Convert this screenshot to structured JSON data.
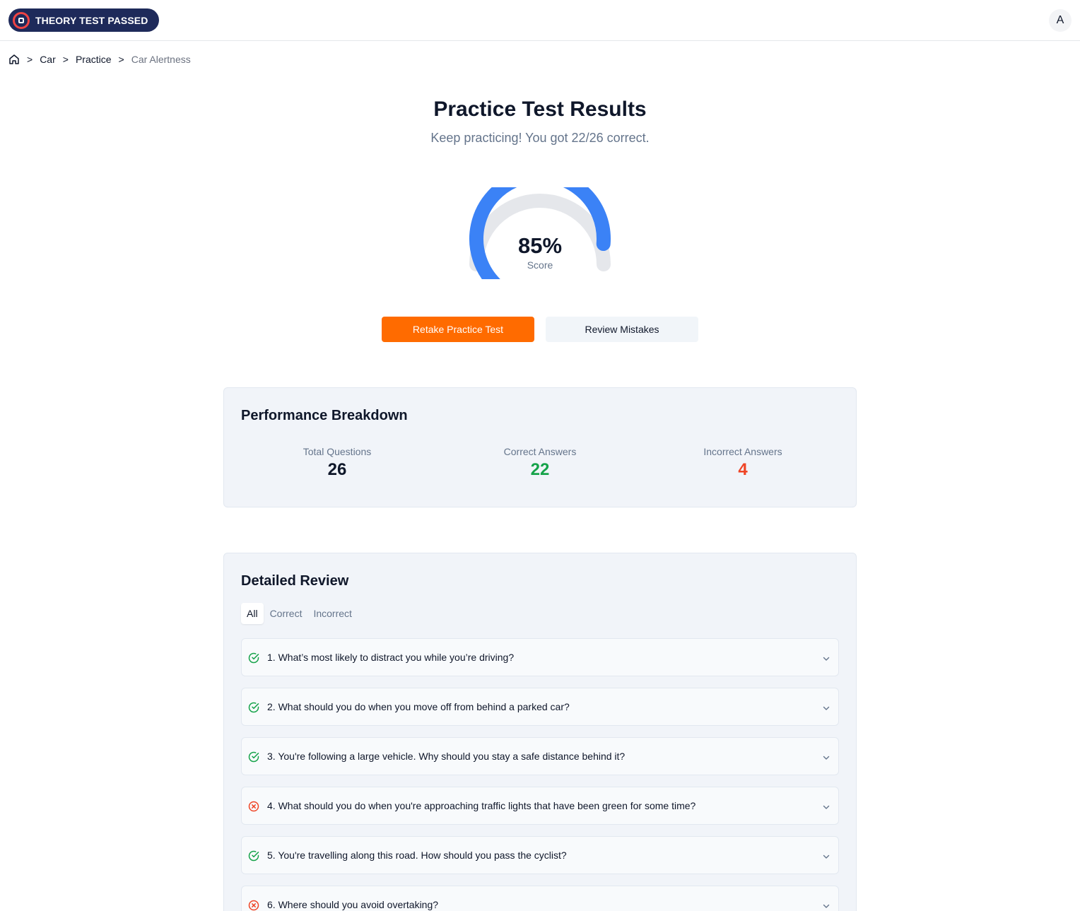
{
  "brand": {
    "name": "THEORY TEST PASSED"
  },
  "user": {
    "avatar_initial": "A"
  },
  "breadcrumb": {
    "items": [
      "Car",
      "Practice"
    ],
    "current": "Car Alertness",
    "separator": ">"
  },
  "results": {
    "title": "Practice Test Results",
    "subtitle": "Keep practicing! You got 22/26 correct.",
    "score_value": "85%",
    "score_fraction": 0.85,
    "score_label": "Score"
  },
  "actions": {
    "retake_label": "Retake Practice Test",
    "review_label": "Review Mistakes"
  },
  "performance": {
    "title": "Performance Breakdown",
    "total_label": "Total Questions",
    "total_value": "26",
    "correct_label": "Correct Answers",
    "correct_value": "22",
    "incorrect_label": "Incorrect Answers",
    "incorrect_value": "4"
  },
  "review": {
    "title": "Detailed Review",
    "tabs": [
      {
        "label": "All",
        "active": true
      },
      {
        "label": "Correct",
        "active": false
      },
      {
        "label": "Incorrect",
        "active": false
      }
    ],
    "questions": [
      {
        "text": "1. What’s most likely to distract you while you’re driving?",
        "status": "correct"
      },
      {
        "text": "2. What should you do when you move off from behind a parked car?",
        "status": "correct"
      },
      {
        "text": "3. You're following a large vehicle. Why should you stay a safe distance behind it?",
        "status": "correct"
      },
      {
        "text": "4. What should you do when you're approaching traffic lights that have been green for some time?",
        "status": "incorrect"
      },
      {
        "text": "5. You're travelling along this road. How should you pass the cyclist?",
        "status": "correct"
      },
      {
        "text": "6. Where should you avoid overtaking?",
        "status": "incorrect"
      }
    ]
  },
  "colors": {
    "brand_navy": "#1e2a5a",
    "accent_orange": "#ff6b00",
    "gauge_blue": "#3b82f6",
    "gauge_track": "#e5e7eb",
    "correct_green": "#16a34a",
    "incorrect_red": "#ef4425"
  }
}
